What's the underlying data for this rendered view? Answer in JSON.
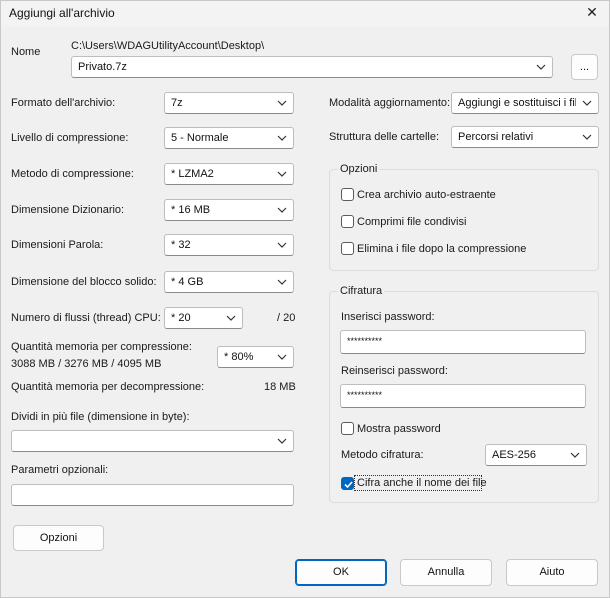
{
  "window": {
    "title": "Aggiungi all'archivio",
    "close_glyph": "✕"
  },
  "name": {
    "label": "Nome",
    "path": "C:\\Users\\WDAGUtilityAccount\\Desktop\\",
    "value": "Privato.7z",
    "browse_label": "..."
  },
  "left": {
    "formato": {
      "label": "Formato dell'archivio:",
      "value": "7z"
    },
    "livello": {
      "label": "Livello di compressione:",
      "value": "5 - Normale"
    },
    "metodo": {
      "label": "Metodo di compressione:",
      "value": "*  LZMA2"
    },
    "dizionario": {
      "label": "Dimensione Dizionario:",
      "value": "*  16 MB"
    },
    "parola": {
      "label": "Dimensioni Parola:",
      "value": "*  32"
    },
    "blocco": {
      "label": "Dimensione del blocco solido:",
      "value": "*  4 GB"
    },
    "flussi": {
      "label": "Numero di flussi (thread) CPU:",
      "value": "*  20",
      "max": "/ 20"
    },
    "mem_comp": {
      "label": "Quantità memoria per compressione:",
      "detail": "3088 MB / 3276 MB / 4095 MB",
      "value": "*  80%"
    },
    "mem_decomp": {
      "label": "Quantità memoria per decompressione:",
      "value": "18 MB"
    },
    "dividi": {
      "label": "Dividi in più file (dimensione in byte):",
      "value": ""
    },
    "parametri": {
      "label": "Parametri opzionali:",
      "value": ""
    },
    "opzioni_button": "Opzioni"
  },
  "right": {
    "modalita": {
      "label": "Modalità aggiornamento:",
      "value": "Aggiungi e sostituisci i file"
    },
    "struttura": {
      "label": "Struttura delle cartelle:",
      "value": "Percorsi relativi"
    },
    "opzioni": {
      "title": "Opzioni",
      "items": [
        {
          "label": "Crea archivio auto-estraente",
          "checked": false
        },
        {
          "label": "Comprimi file condivisi",
          "checked": false
        },
        {
          "label": "Elimina i file dopo la compressione",
          "checked": false
        }
      ]
    },
    "cifratura": {
      "title": "Cifratura",
      "password_label": "Inserisci password:",
      "password_value": "**********",
      "repassword_label": "Reinserisci password:",
      "repassword_value": "**********",
      "show_label": "Mostra password",
      "show_checked": false,
      "method_label": "Metodo cifratura:",
      "method_value": "AES-256",
      "encrypt_names_label": "Cifra anche il nome dei file",
      "encrypt_names_checked": true
    }
  },
  "footer": {
    "ok": "OK",
    "cancel": "Annulla",
    "help": "Aiuto"
  },
  "colors": {
    "accent": "#0067c0",
    "background": "#f0f0f0"
  }
}
